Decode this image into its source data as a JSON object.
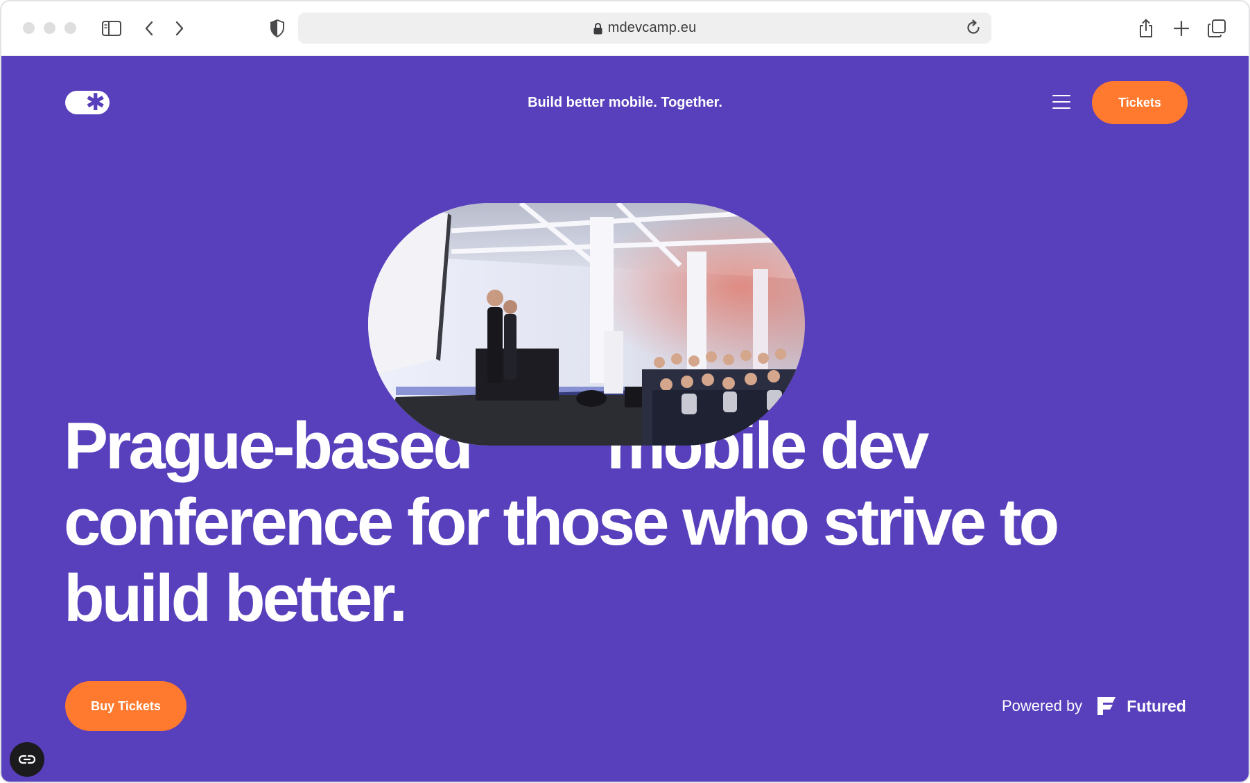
{
  "browser": {
    "url": "mdevcamp.eu",
    "icons": [
      "sidebar-icon",
      "back-arrow-icon",
      "forward-arrow-icon",
      "shield-icon",
      "lock-icon",
      "reload-icon",
      "share-icon",
      "new-tab-icon",
      "tabs-overview-icon"
    ]
  },
  "header": {
    "tagline": "Build better mobile. Together.",
    "tickets_label": "Tickets"
  },
  "hero": {
    "headline_line1_a": "Prague-based",
    "headline_line1_b": "mobile dev",
    "headline_line2": "conference for those who strive to",
    "headline_line3": "build better.",
    "buy_label": "Buy Tickets"
  },
  "footer": {
    "powered_label": "Powered by",
    "brand": "Futured"
  },
  "colors": {
    "page_background": "#5840bd",
    "accent": "#ff7a2f",
    "text": "#ffffff"
  }
}
